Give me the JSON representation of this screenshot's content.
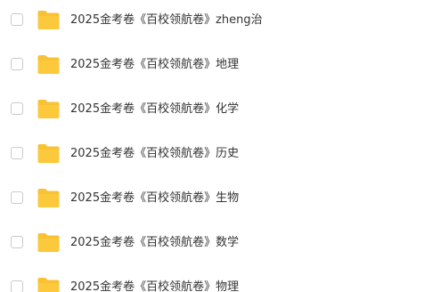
{
  "file_list": {
    "folder_icon": "folder-icon",
    "folder_color": "#f9c235",
    "items": [
      {
        "name": "2025金考卷《百校领航卷》zheng治",
        "checked": false
      },
      {
        "name": "2025金考卷《百校领航卷》地理",
        "checked": false
      },
      {
        "name": "2025金考卷《百校领航卷》化学",
        "checked": false
      },
      {
        "name": "2025金考卷《百校领航卷》历史",
        "checked": false
      },
      {
        "name": "2025金考卷《百校领航卷》生物",
        "checked": false
      },
      {
        "name": "2025金考卷《百校领航卷》数学",
        "checked": false
      },
      {
        "name": "2025金考卷《百校领航卷》物理",
        "checked": false
      }
    ]
  }
}
